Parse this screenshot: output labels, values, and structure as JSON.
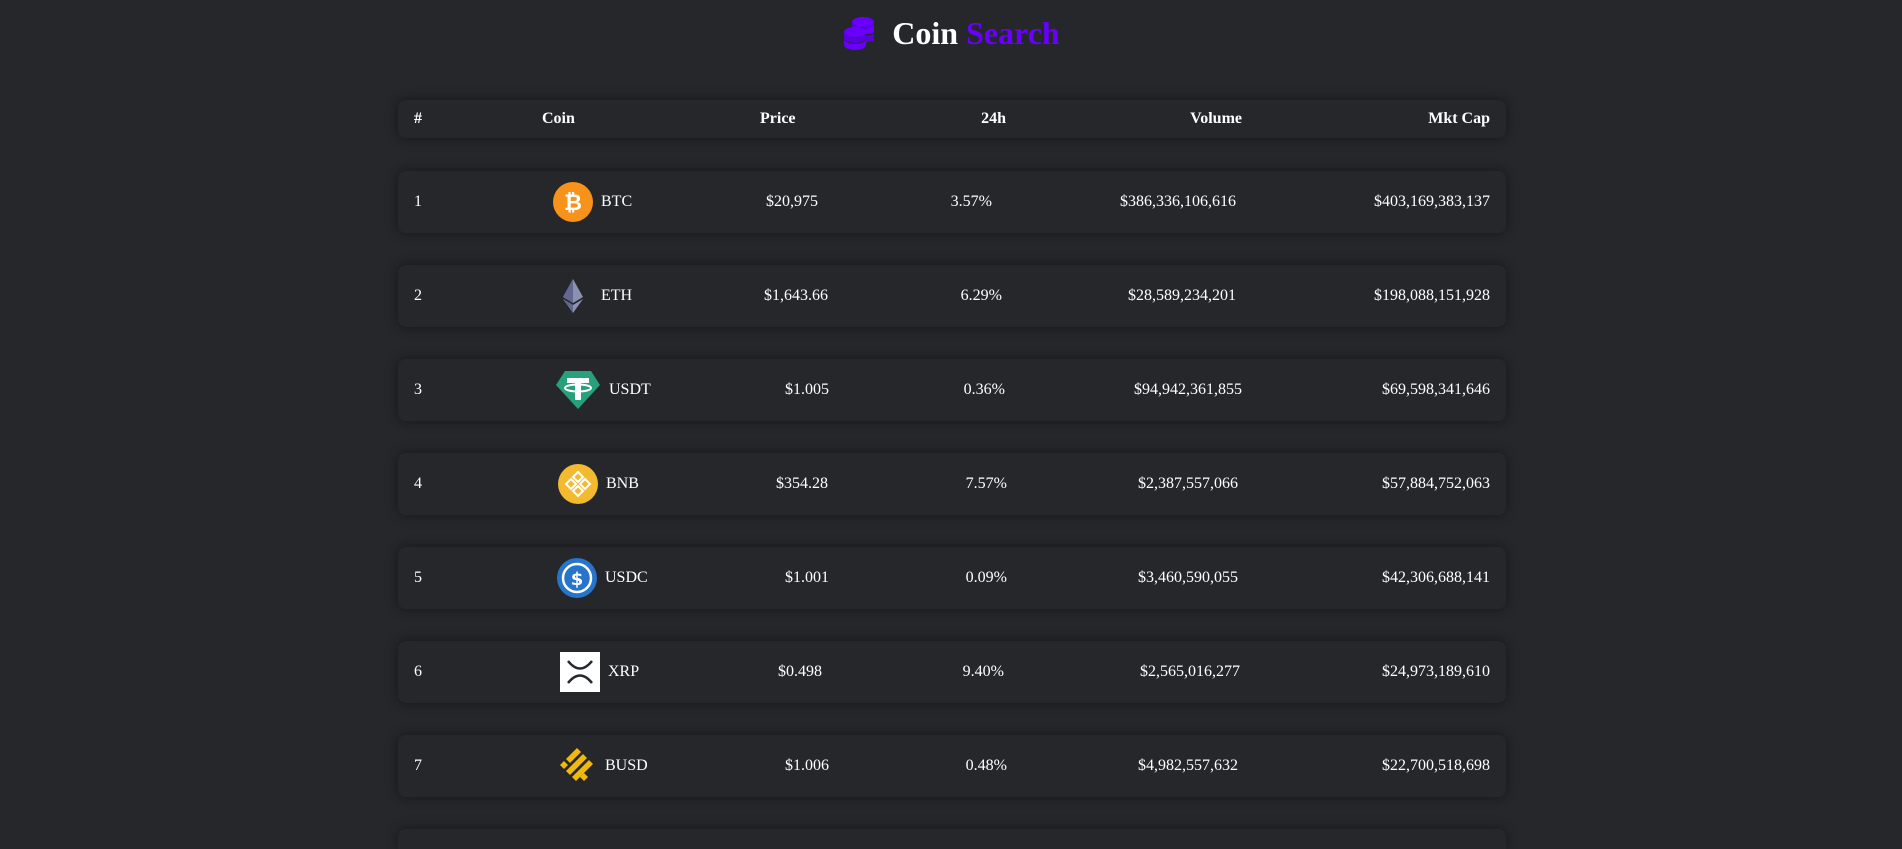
{
  "brand": {
    "icon": "coins-icon",
    "word1": "Coin",
    "word2": "Search",
    "accent": "#6900ff"
  },
  "table": {
    "headers": {
      "rank": "#",
      "coin": "Coin",
      "price": "Price",
      "change": "24h",
      "volume": "Volume",
      "market_cap": "Mkt Cap"
    },
    "rows": [
      {
        "rank": "1",
        "symbol": "BTC",
        "icon": "bitcoin-icon",
        "price": "$20,975",
        "change": "3.57%",
        "volume": "$386,336,106,616",
        "market_cap": "$403,169,383,137"
      },
      {
        "rank": "2",
        "symbol": "ETH",
        "icon": "ethereum-icon",
        "price": "$1,643.66",
        "change": "6.29%",
        "volume": "$28,589,234,201",
        "market_cap": "$198,088,151,928"
      },
      {
        "rank": "3",
        "symbol": "USDT",
        "icon": "tether-icon",
        "price": "$1.005",
        "change": "0.36%",
        "volume": "$94,942,361,855",
        "market_cap": "$69,598,341,646"
      },
      {
        "rank": "4",
        "symbol": "BNB",
        "icon": "bnb-icon",
        "price": "$354.28",
        "change": "7.57%",
        "volume": "$2,387,557,066",
        "market_cap": "$57,884,752,063"
      },
      {
        "rank": "5",
        "symbol": "USDC",
        "icon": "usdc-icon",
        "price": "$1.001",
        "change": "0.09%",
        "volume": "$3,460,590,055",
        "market_cap": "$42,306,688,141"
      },
      {
        "rank": "6",
        "symbol": "XRP",
        "icon": "xrp-icon",
        "price": "$0.498",
        "change": "9.40%",
        "volume": "$2,565,016,277",
        "market_cap": "$24,973,189,610"
      },
      {
        "rank": "7",
        "symbol": "BUSD",
        "icon": "busd-icon",
        "price": "$1.006",
        "change": "0.48%",
        "volume": "$4,982,557,632",
        "market_cap": "$22,700,518,698"
      }
    ]
  },
  "colors": {
    "background": "#26272b",
    "text": "#ffffff",
    "bitcoin": "#f7931a",
    "ethereum": "#8a92b2",
    "tether": "#26a17b",
    "bnb": "#f3ba2f",
    "usdc": "#2775ca",
    "busd": "#f0b90b"
  }
}
